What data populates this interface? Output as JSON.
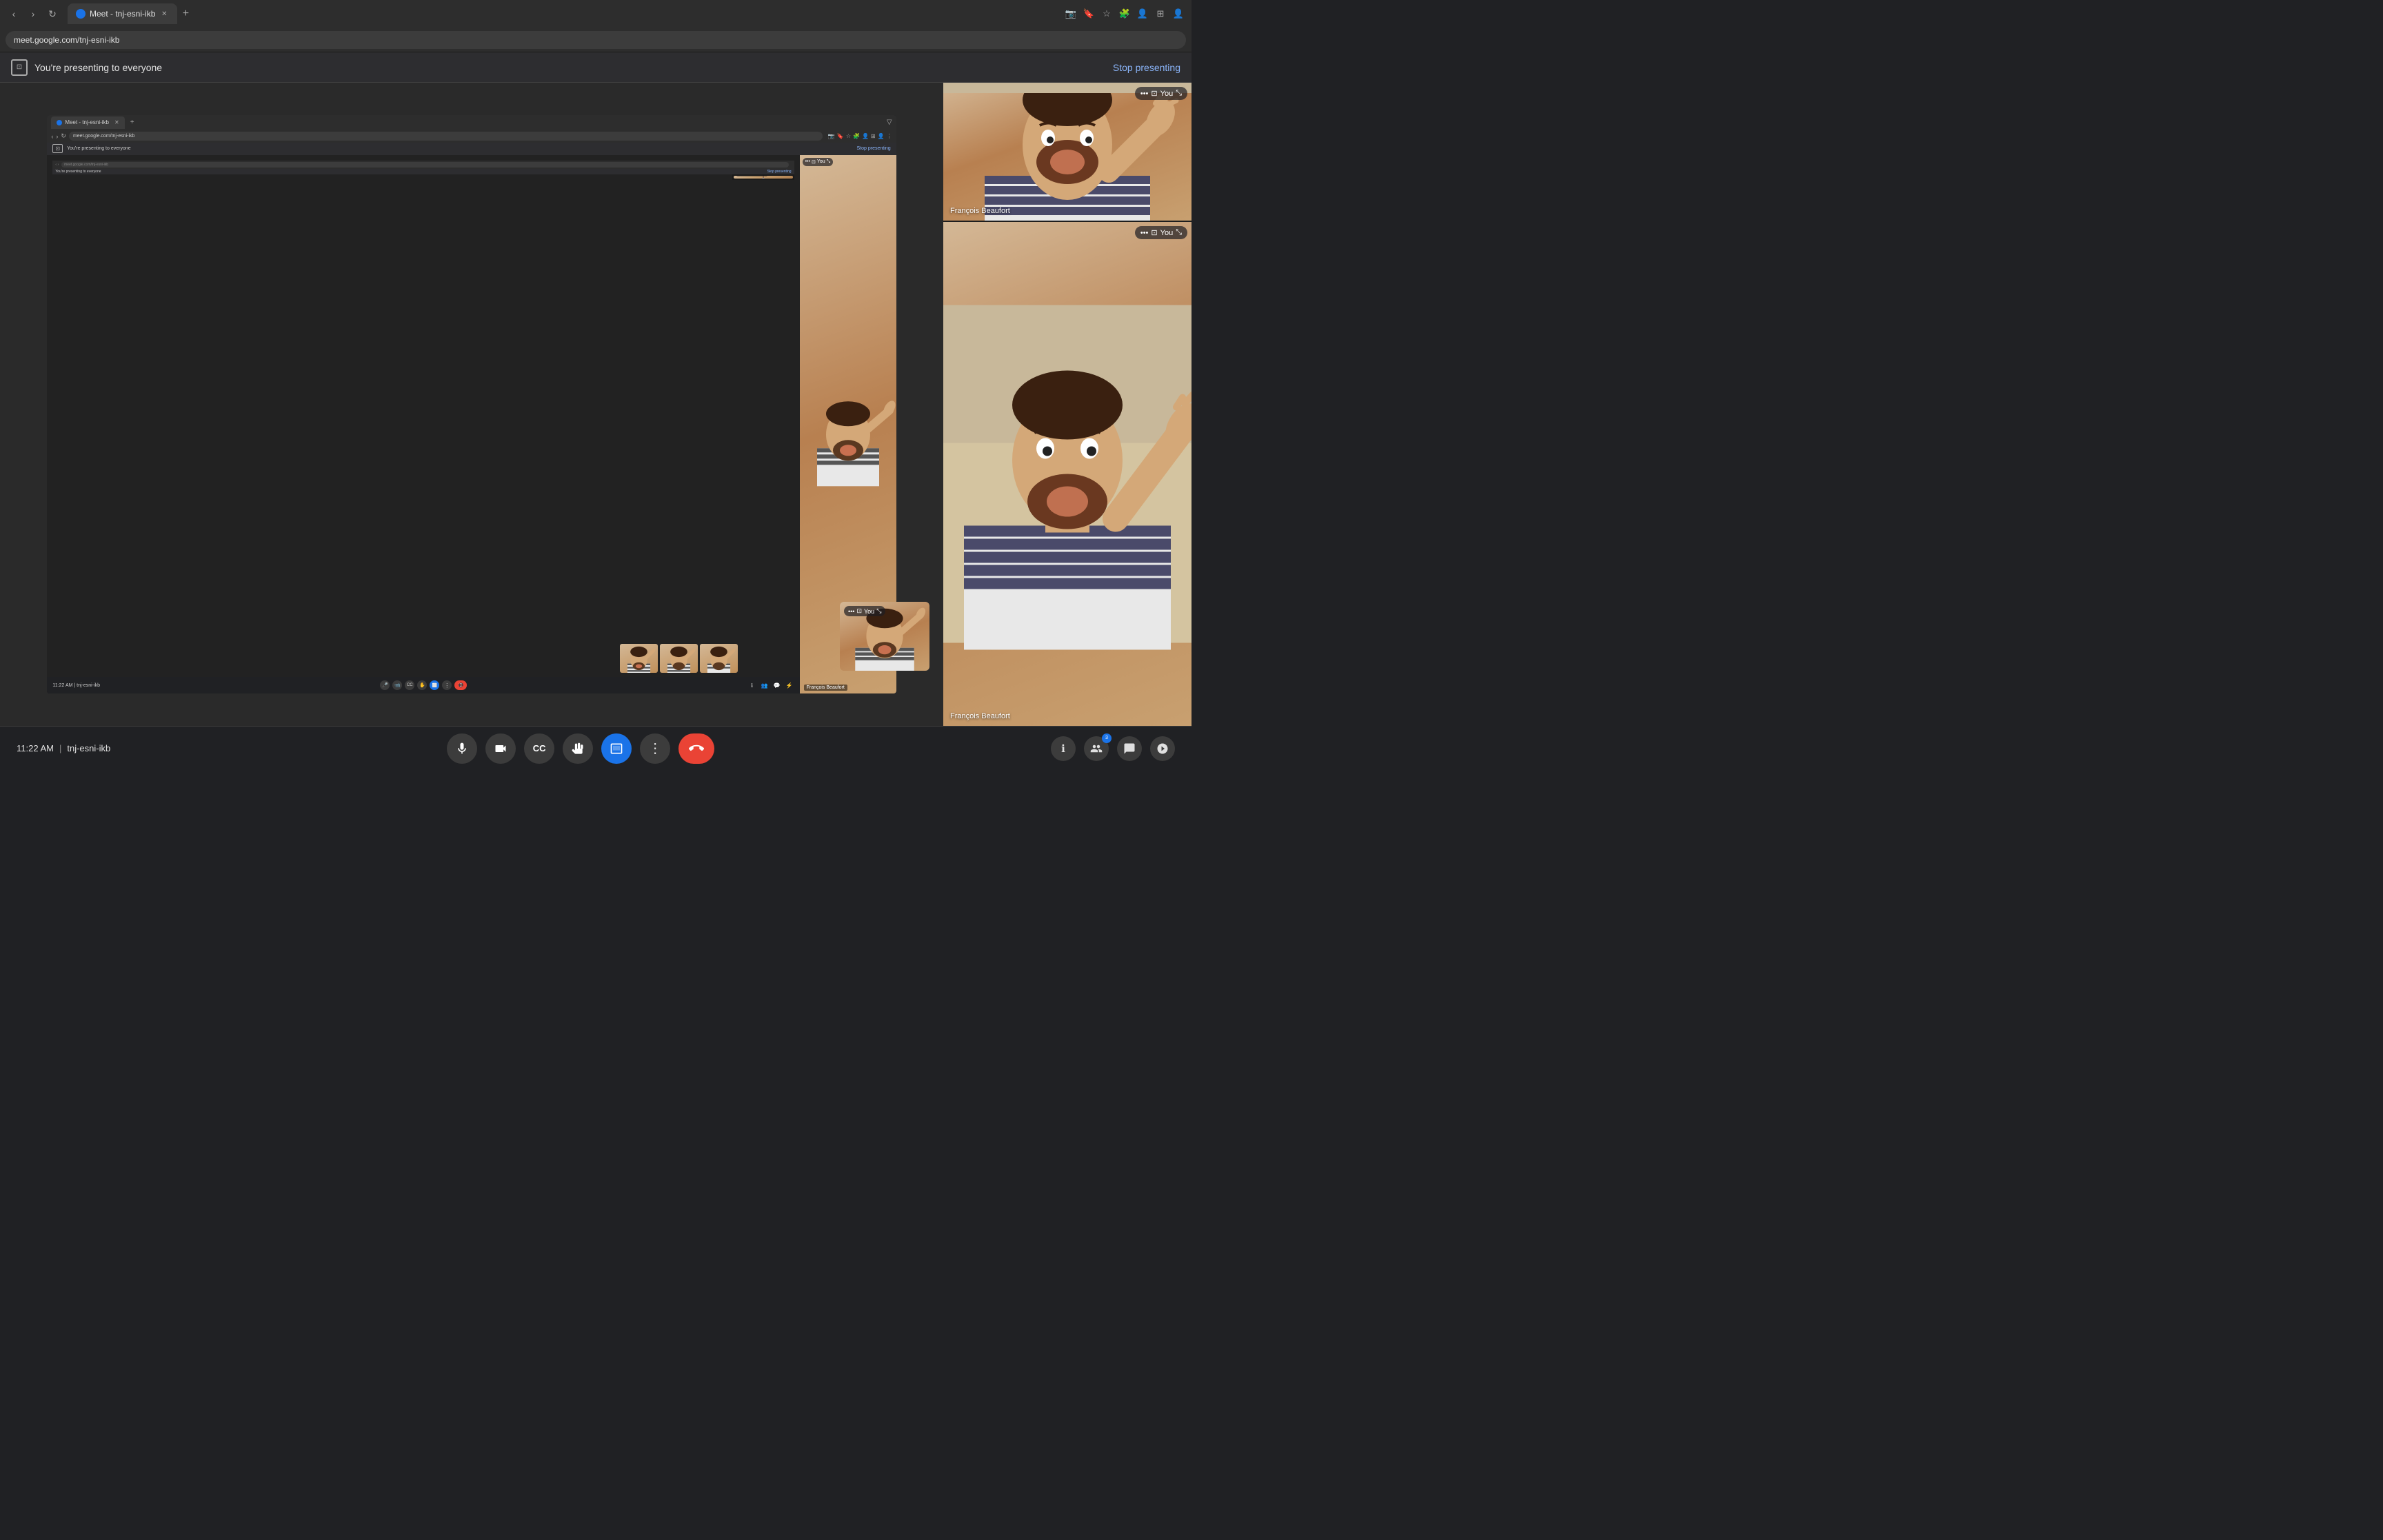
{
  "browser": {
    "tab_title": "Meet - tnj-esni-ikb",
    "url": "meet.google.com/tnj-esni-ikb",
    "new_tab_icon": "+",
    "back_icon": "‹",
    "forward_icon": "›",
    "reload_icon": "↻"
  },
  "presenting_banner": {
    "text": "You're presenting to everyone",
    "stop_btn": "Stop presenting",
    "icon": "⊡"
  },
  "inner_browser": {
    "tab_title": "Meet - tnj-esni-ikb",
    "url": "meet.google.com/tnj-esni-ikb"
  },
  "inner_presenting": {
    "text": "You're presenting to everyone",
    "stop_btn": "Stop presenting"
  },
  "participants": [
    {
      "name": "François Beaufort",
      "id": "francois-1"
    },
    {
      "name": "François Beaufort",
      "id": "francois-2"
    }
  ],
  "you_label": "You",
  "bottom_bar": {
    "time": "11:22 AM",
    "meeting_code": "tnj-esni-ikb",
    "buttons": {
      "mic": "🎤",
      "camera": "📹",
      "captions": "CC",
      "raise_hand": "✋",
      "present": "⬜",
      "more": "⋮",
      "end_call": "📵"
    }
  },
  "right_icons": {
    "info": "ℹ",
    "people": "👥",
    "chat": "💬",
    "activities": "⚡"
  },
  "colors": {
    "active_blue": "#1a73e8",
    "end_red": "#ea4335",
    "bg_dark": "#202124",
    "bg_mid": "#2d2d30",
    "text_light": "#e0e0e0",
    "text_muted": "#aaaaaa",
    "stop_btn_color": "#8ab4f8"
  }
}
